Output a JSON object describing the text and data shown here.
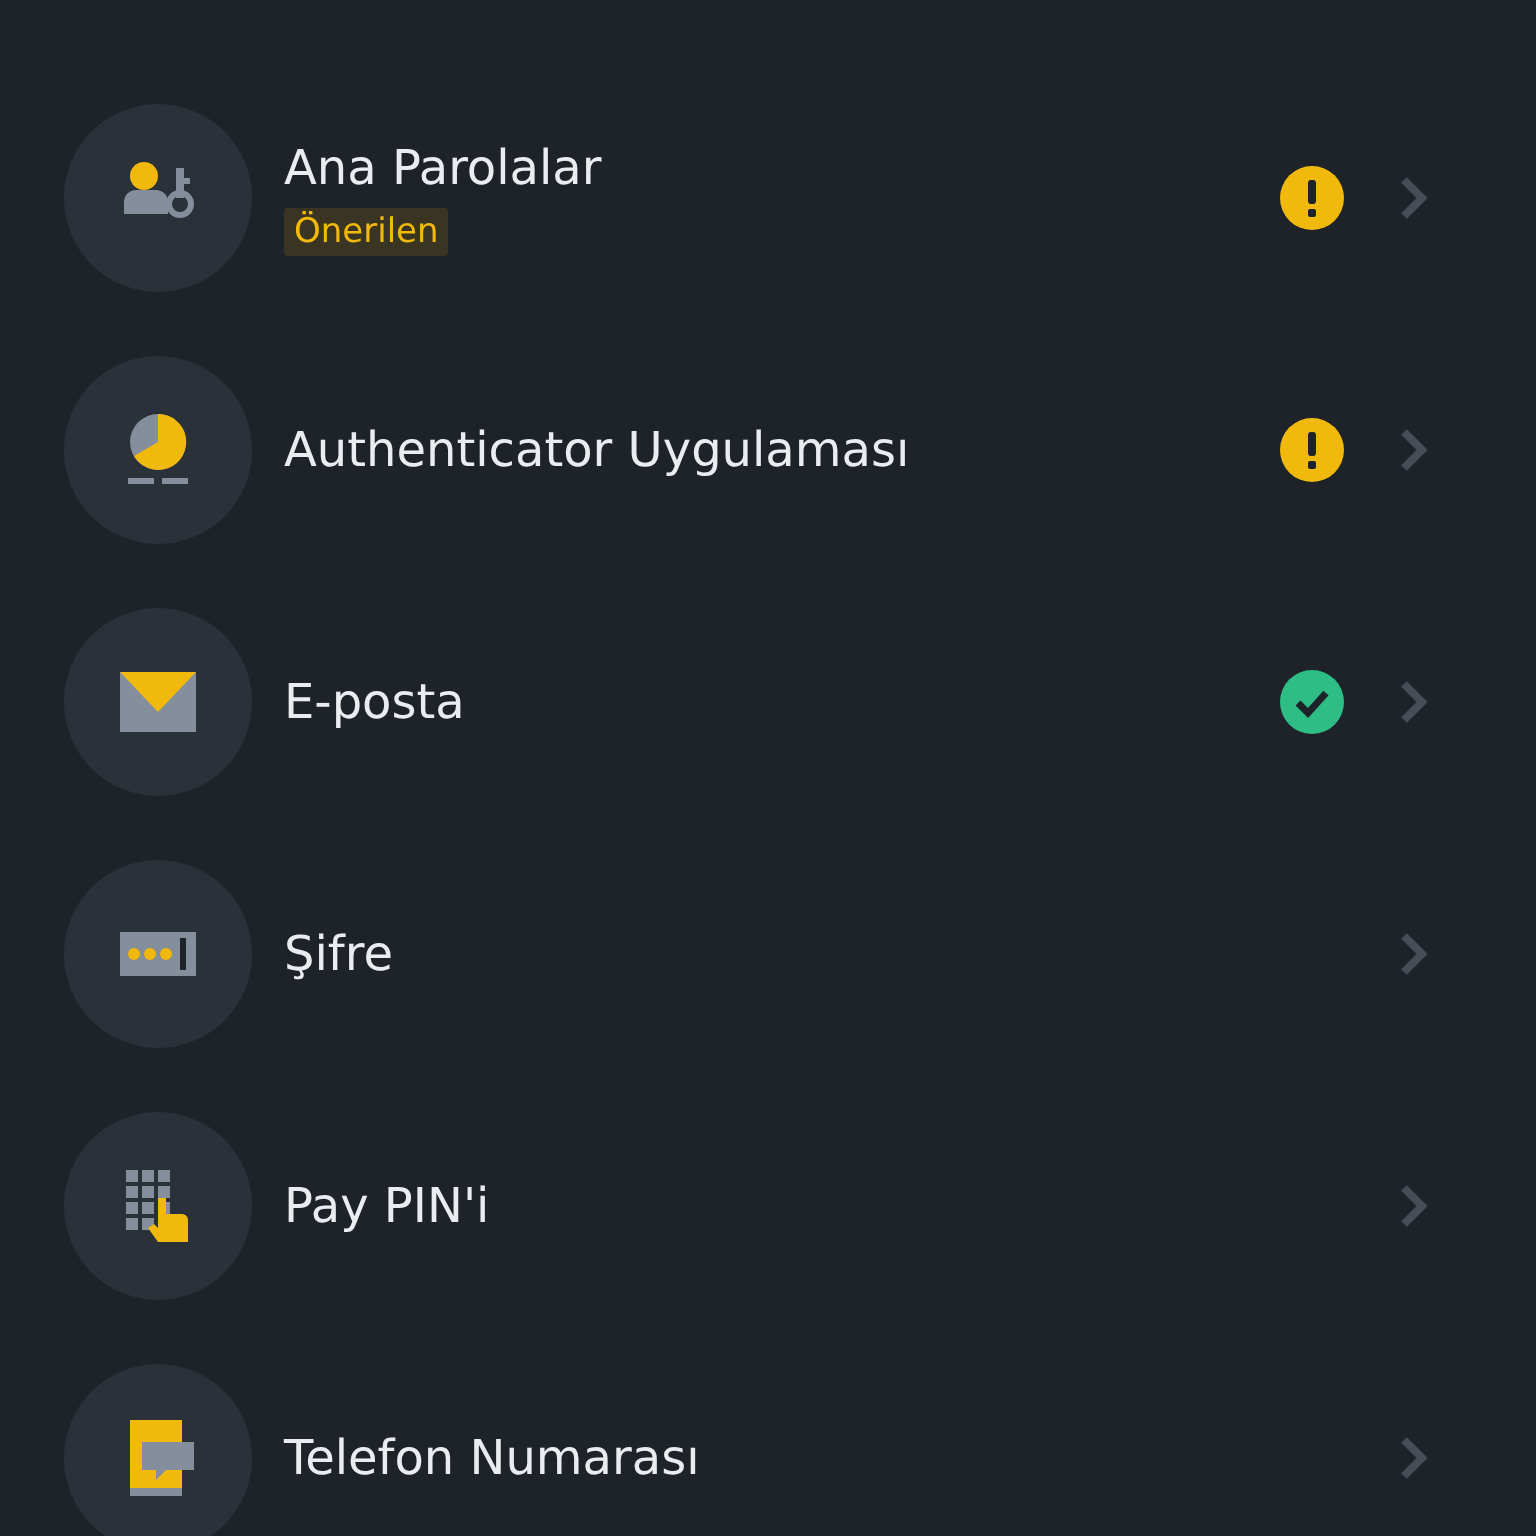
{
  "items": [
    {
      "kind": "passkey",
      "title": "Ana Parolalar",
      "badge": "Önerilen",
      "warning": true,
      "verified": false
    },
    {
      "kind": "authenticator",
      "title": "Authenticator Uygulaması",
      "warning": true,
      "verified": false
    },
    {
      "kind": "email",
      "title": "E-posta",
      "warning": false,
      "verified": true
    },
    {
      "kind": "password",
      "title": "Şifre",
      "warning": false,
      "verified": false
    },
    {
      "kind": "pin",
      "title": "Pay PIN'i",
      "warning": false,
      "verified": false
    },
    {
      "kind": "phone",
      "title": "Telefon Numarası",
      "warning": false,
      "verified": false
    }
  ]
}
